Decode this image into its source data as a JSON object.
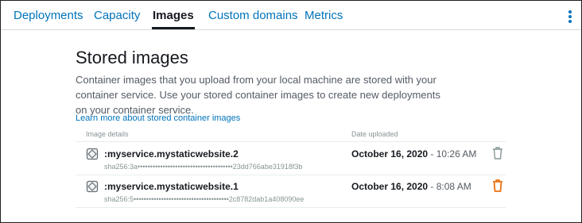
{
  "tabs": [
    {
      "label": "Deployments",
      "active": false
    },
    {
      "label": "Capacity",
      "active": false
    },
    {
      "label": "Images",
      "active": true
    },
    {
      "label": "Custom domains",
      "active": false
    },
    {
      "label": "Metrics",
      "active": false
    }
  ],
  "header": {
    "menu_icon": "vertical-ellipsis-icon"
  },
  "section": {
    "title": "Stored images",
    "description": "Container images that you upload from your local machine are stored with your container service. Use your stored container images to create new deployments on your container service.",
    "learn_more_link": "Learn more about stored container images"
  },
  "table": {
    "columns": [
      "Image details",
      "Date uploaded"
    ],
    "rows": [
      {
        "name": ":myservice.mystaticwebsite.2",
        "sha": "sha256:3a••••••••••••••••••••••••••••••••••••••23dd766abe31918f3b",
        "date": "October 16, 2020",
        "time": " - 10:26 AM",
        "delete_icon": "trash-icon",
        "delete_color": "#879596"
      },
      {
        "name": ":myservice.mystaticwebsite.1",
        "sha": "sha256:5••••••••••••••••••••••••••••••••••••••2c8782dab1a408090ee",
        "date": "October 16, 2020",
        "time": " - 8:08 AM",
        "delete_icon": "trash-icon",
        "delete_color": "#ec7211"
      }
    ]
  },
  "colors": {
    "link": "#0073bb",
    "text_primary": "#16191f",
    "text_secondary": "#545b64",
    "muted": "#879596",
    "accent_orange": "#ec7211"
  }
}
